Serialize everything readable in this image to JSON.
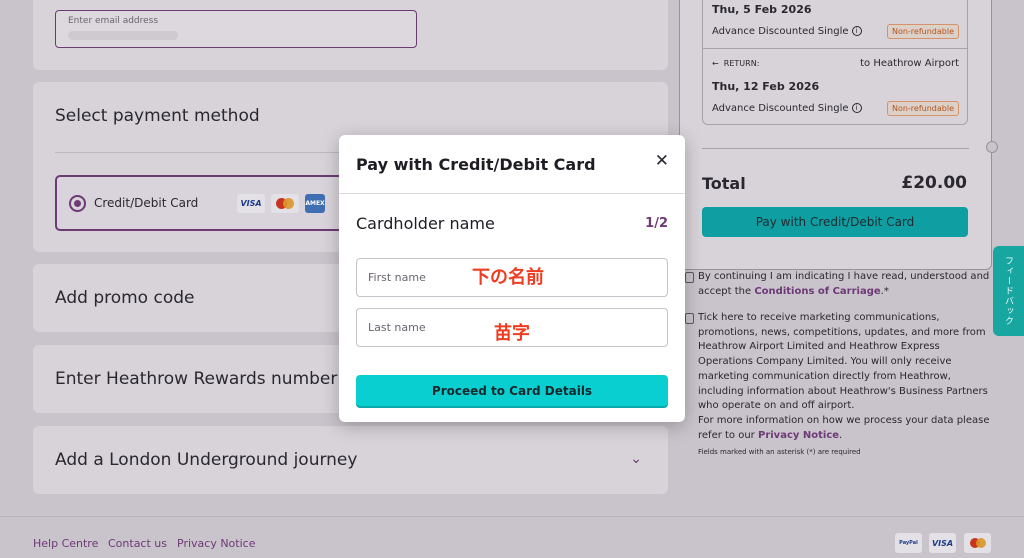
{
  "email": {
    "label": "Enter email address"
  },
  "payment": {
    "title": "Select payment method",
    "option_label": "Credit/Debit Card",
    "brands": {
      "visa": "VISA",
      "amex": "AMEX"
    }
  },
  "sections": {
    "promo": "Add promo code",
    "rewards": "Enter Heathrow Rewards number",
    "underground": "Add a London Underground journey"
  },
  "summary": {
    "outbound_date": "Thu, 5 Feb 2026",
    "outbound_type": "Advance Discounted Single",
    "outbound_badge": "Non-refundable",
    "return_tag": "RETURN:",
    "return_to": "to Heathrow Airport",
    "return_date": "Thu, 12 Feb 2026",
    "return_type": "Advance Discounted Single",
    "return_badge": "Non-refundable",
    "total_label": "Total",
    "total_value": "£20.00",
    "pay_button": "Pay with Credit/Debit Card"
  },
  "consent": {
    "terms_text": "By continuing I am indicating I have read, understood and accept the ",
    "terms_link": "Conditions of Carriage",
    "terms_asterisk": ".*",
    "marketing_text": "Tick here to receive marketing communications, promotions, news, competitions, updates, and more from Heathrow Airport Limited and Heathrow Express Operations Company Limited. You will only receive marketing communication directly from Heathrow, including information about Heathrow's Business Partners who operate on and off airport.",
    "privacy_prefix": "For more information on how we process your data please refer to our ",
    "privacy_link": "Privacy Notice",
    "privacy_suffix": ".",
    "required_note": "Fields marked with an asterisk (*) are required"
  },
  "feedback_tab": "フィードバック",
  "footer": {
    "links": [
      "Help Centre",
      "Contact us",
      "Privacy Notice"
    ],
    "payment_icons": {
      "paypal": "PayPal",
      "visa": "VISA"
    }
  },
  "modal": {
    "title": "Pay with Credit/Debit Card",
    "section": "Cardholder name",
    "step": "1/2",
    "first_name_placeholder": "First name",
    "last_name_placeholder": "Last name",
    "first_name_annotation": "下の名前",
    "last_name_annotation": "苗字",
    "proceed": "Proceed to Card Details"
  }
}
